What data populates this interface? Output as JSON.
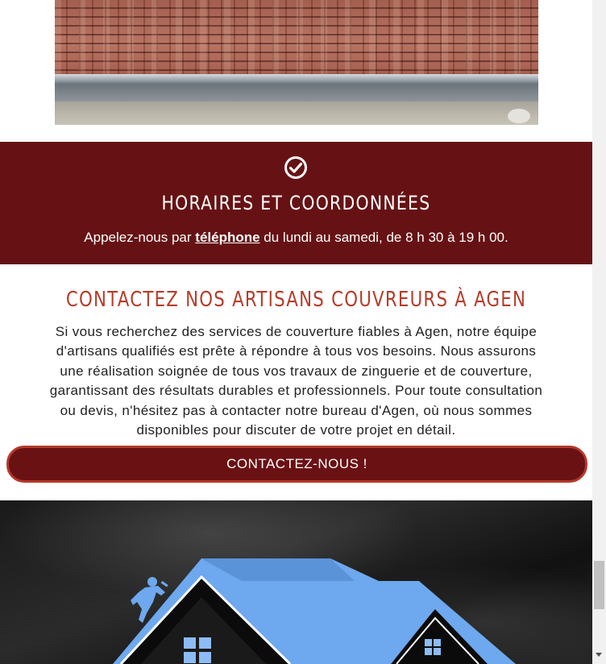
{
  "hours": {
    "title": "HORAIRES ET COORDONNÉES",
    "text_before": "Appelez-nous par ",
    "phone_link": "téléphone",
    "text_after": " du lundi au samedi, de 8 h 30 à 19 h 00."
  },
  "contact": {
    "title": "CONTACTEZ NOS ARTISANS COUVREURS À AGEN",
    "body_lines": [
      "Si vous recherchez des services de couverture fiables à Agen, notre équipe",
      "d'artisans qualifiés est prête à répondre à tous vos besoins. Nous assurons",
      "une réalisation soignée de tous vos travaux de zinguerie et de couverture,",
      "garantissant des résultats durables et professionnels. Pour toute consultation",
      "ou devis, n'hésitez pas à contacter notre bureau d'Agen, où nous sommes",
      "disponibles pour discuter de votre projet en détail."
    ],
    "button_label": "CONTACTEZ-NOUS !"
  },
  "colors": {
    "band": "#661214",
    "title_accent": "#b53d2a",
    "button_border": "#b43a2b",
    "house_blue": "#6ea8ee"
  },
  "icons": [
    "check-circle-icon",
    "roofer-worker-icon",
    "house-logo-icon"
  ]
}
